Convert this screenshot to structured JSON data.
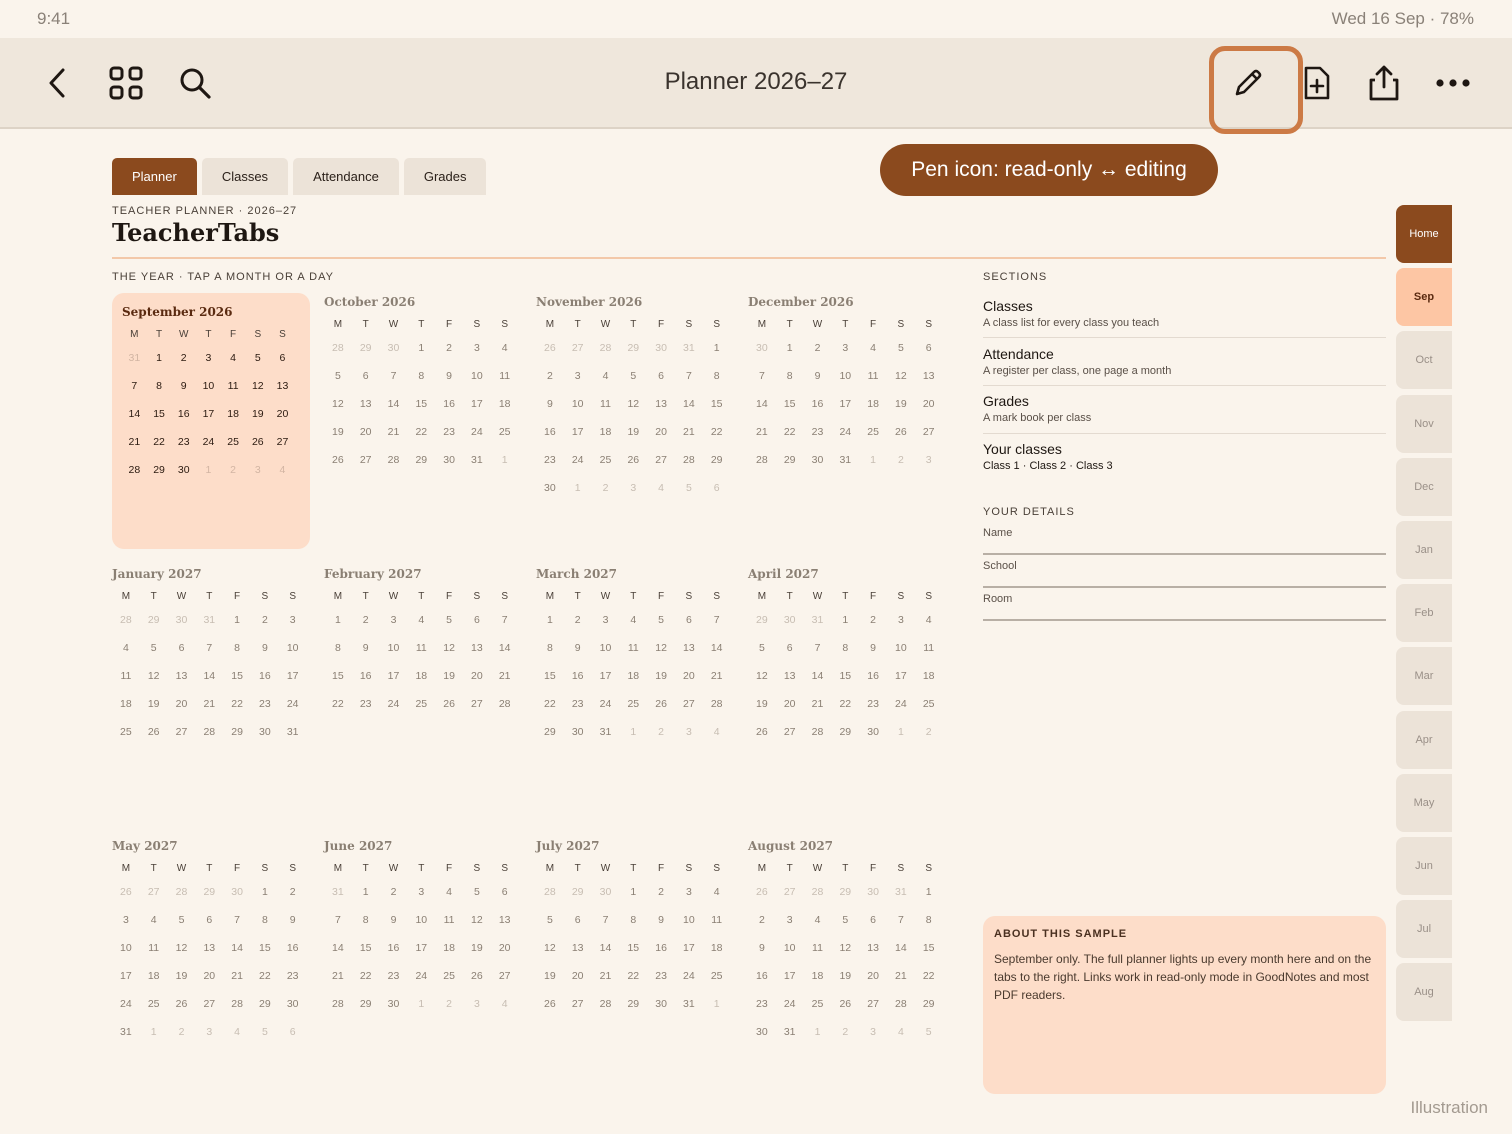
{
  "status": {
    "time": "9:41",
    "right": "Wed 16 Sep · 78%"
  },
  "toolbar": {
    "title": "Planner 2026–27",
    "left_icons": [
      "chevron-left-icon",
      "grid-icon",
      "search-icon"
    ],
    "right_icons": [
      "pencil-icon",
      "add-page-icon",
      "share-icon",
      "more-icon"
    ]
  },
  "tabs": [
    {
      "label": "Planner",
      "active": true
    },
    {
      "label": "Classes",
      "active": false
    },
    {
      "label": "Attendance",
      "active": false
    },
    {
      "label": "Grades",
      "active": false
    }
  ],
  "callout": "Pen icon: read-only ↔ editing",
  "brand": {
    "subtitle": "TEACHER PLANNER · 2026–27",
    "name": "TeacherTabs"
  },
  "year_label": "THE YEAR · TAP A MONTH OR A DAY",
  "dow": [
    "M",
    "T",
    "W",
    "T",
    "F",
    "S",
    "S"
  ],
  "months": [
    {
      "name": "September 2026",
      "current": true,
      "weeks": [
        [
          "31",
          "1",
          "2",
          "3",
          "4",
          "5",
          "6"
        ],
        [
          "7",
          "8",
          "9",
          "10",
          "11",
          "12",
          "13"
        ],
        [
          "14",
          "15",
          "16",
          "17",
          "18",
          "19",
          "20"
        ],
        [
          "21",
          "22",
          "23",
          "24",
          "25",
          "26",
          "27"
        ],
        [
          "28",
          "29",
          "30",
          "1",
          "2",
          "3",
          "4"
        ]
      ]
    },
    {
      "name": "October 2026",
      "weeks": [
        [
          "28",
          "29",
          "30",
          "1",
          "2",
          "3",
          "4"
        ],
        [
          "5",
          "6",
          "7",
          "8",
          "9",
          "10",
          "11"
        ],
        [
          "12",
          "13",
          "14",
          "15",
          "16",
          "17",
          "18"
        ],
        [
          "19",
          "20",
          "21",
          "22",
          "23",
          "24",
          "25"
        ],
        [
          "26",
          "27",
          "28",
          "29",
          "30",
          "31",
          "1"
        ]
      ]
    },
    {
      "name": "November 2026",
      "weeks": [
        [
          "26",
          "27",
          "28",
          "29",
          "30",
          "31",
          "1"
        ],
        [
          "2",
          "3",
          "4",
          "5",
          "6",
          "7",
          "8"
        ],
        [
          "9",
          "10",
          "11",
          "12",
          "13",
          "14",
          "15"
        ],
        [
          "16",
          "17",
          "18",
          "19",
          "20",
          "21",
          "22"
        ],
        [
          "23",
          "24",
          "25",
          "26",
          "27",
          "28",
          "29"
        ],
        [
          "30",
          "1",
          "2",
          "3",
          "4",
          "5",
          "6"
        ]
      ]
    },
    {
      "name": "December 2026",
      "weeks": [
        [
          "30",
          "1",
          "2",
          "3",
          "4",
          "5",
          "6"
        ],
        [
          "7",
          "8",
          "9",
          "10",
          "11",
          "12",
          "13"
        ],
        [
          "14",
          "15",
          "16",
          "17",
          "18",
          "19",
          "20"
        ],
        [
          "21",
          "22",
          "23",
          "24",
          "25",
          "26",
          "27"
        ],
        [
          "28",
          "29",
          "30",
          "31",
          "1",
          "2",
          "3"
        ]
      ]
    },
    {
      "name": "January 2027",
      "weeks": [
        [
          "28",
          "29",
          "30",
          "31",
          "1",
          "2",
          "3"
        ],
        [
          "4",
          "5",
          "6",
          "7",
          "8",
          "9",
          "10"
        ],
        [
          "11",
          "12",
          "13",
          "14",
          "15",
          "16",
          "17"
        ],
        [
          "18",
          "19",
          "20",
          "21",
          "22",
          "23",
          "24"
        ],
        [
          "25",
          "26",
          "27",
          "28",
          "29",
          "30",
          "31"
        ]
      ]
    },
    {
      "name": "February 2027",
      "weeks": [
        [
          "1",
          "2",
          "3",
          "4",
          "5",
          "6",
          "7"
        ],
        [
          "8",
          "9",
          "10",
          "11",
          "12",
          "13",
          "14"
        ],
        [
          "15",
          "16",
          "17",
          "18",
          "19",
          "20",
          "21"
        ],
        [
          "22",
          "23",
          "24",
          "25",
          "26",
          "27",
          "28"
        ]
      ]
    },
    {
      "name": "March 2027",
      "weeks": [
        [
          "1",
          "2",
          "3",
          "4",
          "5",
          "6",
          "7"
        ],
        [
          "8",
          "9",
          "10",
          "11",
          "12",
          "13",
          "14"
        ],
        [
          "15",
          "16",
          "17",
          "18",
          "19",
          "20",
          "21"
        ],
        [
          "22",
          "23",
          "24",
          "25",
          "26",
          "27",
          "28"
        ],
        [
          "29",
          "30",
          "31",
          "1",
          "2",
          "3",
          "4"
        ]
      ]
    },
    {
      "name": "April 2027",
      "weeks": [
        [
          "29",
          "30",
          "31",
          "1",
          "2",
          "3",
          "4"
        ],
        [
          "5",
          "6",
          "7",
          "8",
          "9",
          "10",
          "11"
        ],
        [
          "12",
          "13",
          "14",
          "15",
          "16",
          "17",
          "18"
        ],
        [
          "19",
          "20",
          "21",
          "22",
          "23",
          "24",
          "25"
        ],
        [
          "26",
          "27",
          "28",
          "29",
          "30",
          "1",
          "2"
        ]
      ]
    },
    {
      "name": "May 2027",
      "weeks": [
        [
          "26",
          "27",
          "28",
          "29",
          "30",
          "1",
          "2"
        ],
        [
          "3",
          "4",
          "5",
          "6",
          "7",
          "8",
          "9"
        ],
        [
          "10",
          "11",
          "12",
          "13",
          "14",
          "15",
          "16"
        ],
        [
          "17",
          "18",
          "19",
          "20",
          "21",
          "22",
          "23"
        ],
        [
          "24",
          "25",
          "26",
          "27",
          "28",
          "29",
          "30"
        ],
        [
          "31",
          "1",
          "2",
          "3",
          "4",
          "5",
          "6"
        ]
      ]
    },
    {
      "name": "June 2027",
      "weeks": [
        [
          "31",
          "1",
          "2",
          "3",
          "4",
          "5",
          "6"
        ],
        [
          "7",
          "8",
          "9",
          "10",
          "11",
          "12",
          "13"
        ],
        [
          "14",
          "15",
          "16",
          "17",
          "18",
          "19",
          "20"
        ],
        [
          "21",
          "22",
          "23",
          "24",
          "25",
          "26",
          "27"
        ],
        [
          "28",
          "29",
          "30",
          "1",
          "2",
          "3",
          "4"
        ]
      ]
    },
    {
      "name": "July 2027",
      "weeks": [
        [
          "28",
          "29",
          "30",
          "1",
          "2",
          "3",
          "4"
        ],
        [
          "5",
          "6",
          "7",
          "8",
          "9",
          "10",
          "11"
        ],
        [
          "12",
          "13",
          "14",
          "15",
          "16",
          "17",
          "18"
        ],
        [
          "19",
          "20",
          "21",
          "22",
          "23",
          "24",
          "25"
        ],
        [
          "26",
          "27",
          "28",
          "29",
          "30",
          "31",
          "1"
        ]
      ]
    },
    {
      "name": "August 2027",
      "weeks": [
        [
          "26",
          "27",
          "28",
          "29",
          "30",
          "31",
          "1"
        ],
        [
          "2",
          "3",
          "4",
          "5",
          "6",
          "7",
          "8"
        ],
        [
          "9",
          "10",
          "11",
          "12",
          "13",
          "14",
          "15"
        ],
        [
          "16",
          "17",
          "18",
          "19",
          "20",
          "21",
          "22"
        ],
        [
          "23",
          "24",
          "25",
          "26",
          "27",
          "28",
          "29"
        ],
        [
          "30",
          "31",
          "1",
          "2",
          "3",
          "4",
          "5"
        ]
      ]
    }
  ],
  "sections": {
    "heading": "SECTIONS",
    "items": [
      {
        "title": "Classes",
        "desc": "A class list for every class you teach"
      },
      {
        "title": "Attendance",
        "desc": "A register per class, one page a month"
      },
      {
        "title": "Grades",
        "desc": "A mark book per class"
      }
    ],
    "your_classes": {
      "title": "Your classes",
      "classes": [
        "Class 1",
        "Class 2",
        "Class 3"
      ]
    }
  },
  "details": {
    "heading": "YOUR DETAILS",
    "fields": [
      "Name",
      "School",
      "Room"
    ]
  },
  "about": {
    "heading": "ABOUT THIS SAMPLE",
    "text": "September only. The full planner lights up every month here and on the tabs to the right. Links work in read-only mode in GoodNotes and most PDF readers."
  },
  "side_tabs": [
    "Home",
    "Sep",
    "Oct",
    "Nov",
    "Dec",
    "Jan",
    "Feb",
    "Mar",
    "Apr",
    "May",
    "Jun",
    "Jul",
    "Aug"
  ],
  "footer": "Illustration",
  "colors": {
    "accent": "#8b4a1e",
    "highlight": "#fdddc9",
    "ring": "#cc7a45",
    "background": "#faf4ec"
  }
}
